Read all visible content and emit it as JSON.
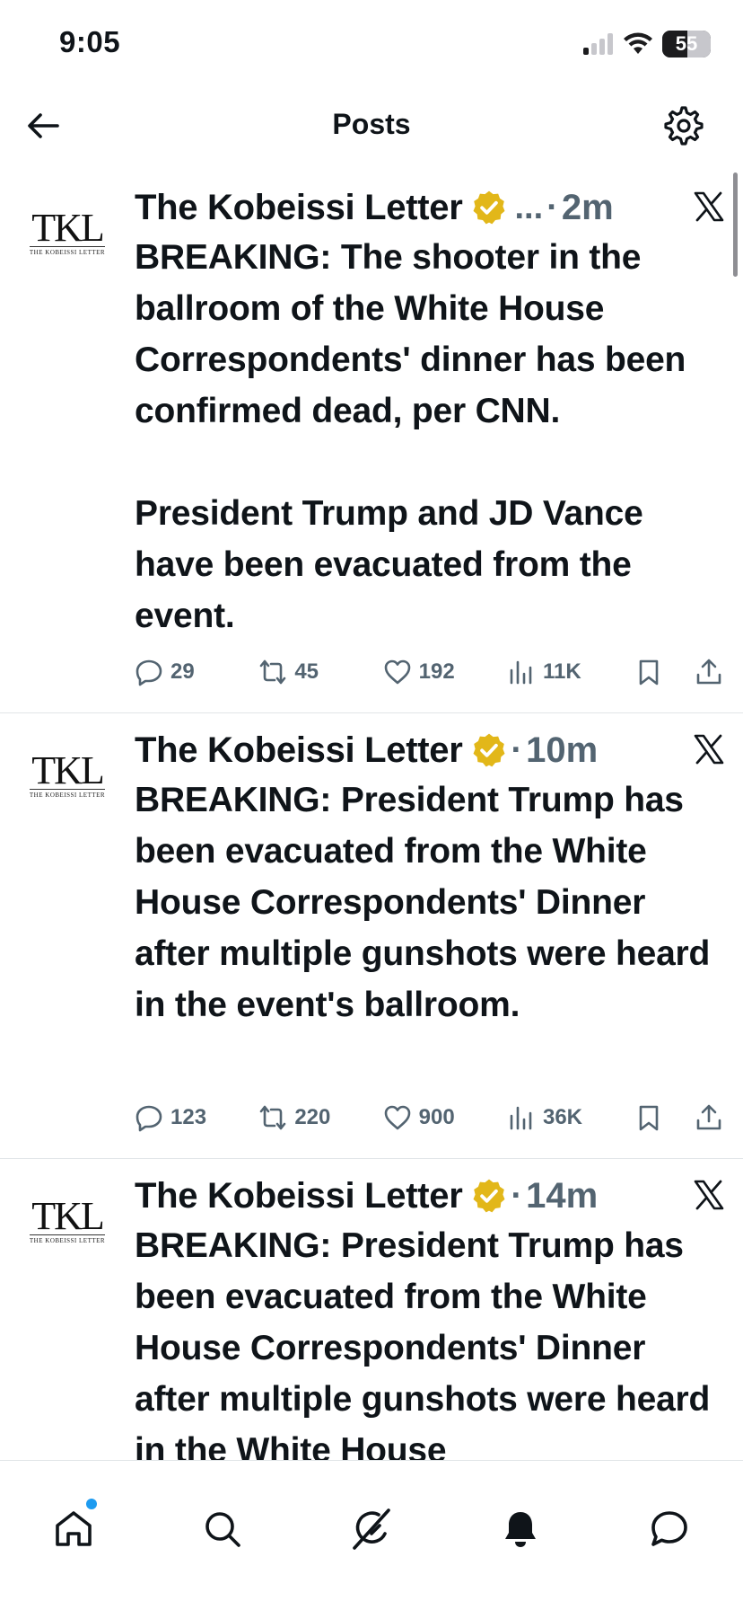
{
  "status_bar": {
    "time": "9:05",
    "battery": "55",
    "icons": [
      "signal-icon",
      "wifi-icon",
      "battery-icon"
    ]
  },
  "header": {
    "title": "Posts",
    "back_icon": "arrow-left-icon",
    "settings_icon": "gear-icon"
  },
  "posts": [
    {
      "author": "The Kobeissi Letter",
      "avatar_text": "TKL",
      "avatar_subtext": "THE KOBEISSI LETTER",
      "truncated": "...",
      "separator": "·",
      "time": "2m",
      "text": "BREAKING: The shooter in the ballroom of the White House Correspondents' dinner has been confirmed dead, per CNN.\n\nPresident Trump and JD Vance have been evacuated from the event.",
      "replies": "29",
      "reposts": "45",
      "likes": "192",
      "views": "11K"
    },
    {
      "author": "The Kobeissi Letter",
      "avatar_text": "TKL",
      "avatar_subtext": "THE KOBEISSI LETTER",
      "separator": "·",
      "time": "10m",
      "text": "BREAKING: President Trump has been evacuated from the White House Correspondents' Dinner after multiple gunshots were heard in the event's ballroom.",
      "replies": "123",
      "reposts": "220",
      "likes": "900",
      "views": "36K"
    },
    {
      "author": "The Kobeissi Letter",
      "avatar_text": "TKL",
      "avatar_subtext": "THE KOBEISSI LETTER",
      "separator": "·",
      "time": "14m",
      "text": "BREAKING: President Trump has been evacuated from the White House Correspondents' Dinner after multiple gunshots were heard in the White House"
    }
  ],
  "bottom_nav": {
    "items": [
      "home-icon",
      "search-icon",
      "grok-icon",
      "bell-icon",
      "message-icon"
    ]
  },
  "colors": {
    "accent": "#1d9bf0",
    "verified": "#e2b719",
    "muted": "#536471",
    "text": "#0f1419"
  }
}
